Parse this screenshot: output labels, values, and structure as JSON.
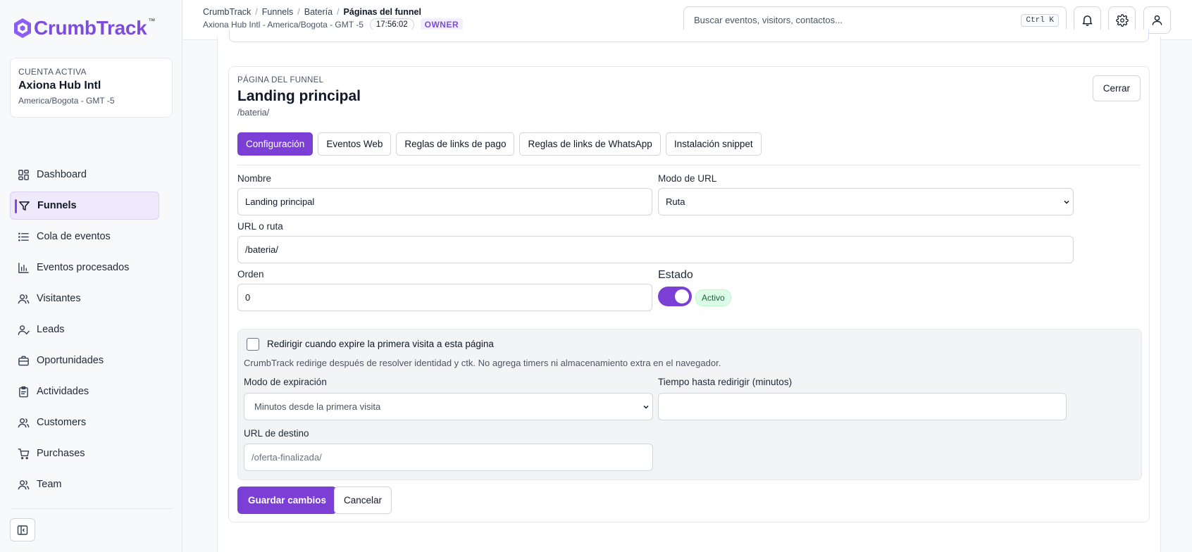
{
  "brand": {
    "name": "CrumbTrack",
    "tm": "™",
    "accent": "#7c3fd6"
  },
  "account": {
    "label": "CUENTA ACTIVA",
    "name": "Axiona Hub Intl",
    "timezone": "America/Bogota - GMT -5"
  },
  "nav": [
    {
      "label": "Dashboard",
      "icon": "dashboard-icon"
    },
    {
      "label": "Funnels",
      "icon": "filter-icon",
      "active": true
    },
    {
      "label": "Cola de eventos",
      "icon": "list-icon"
    },
    {
      "label": "Eventos procesados",
      "icon": "bar-chart-icon"
    },
    {
      "label": "Visitantes",
      "icon": "users-icon"
    },
    {
      "label": "Leads",
      "icon": "user-check-icon"
    },
    {
      "label": "Oportunidades",
      "icon": "briefcase-icon"
    },
    {
      "label": "Actividades",
      "icon": "clipboard-icon"
    },
    {
      "label": "Customers",
      "icon": "users-icon"
    },
    {
      "label": "Purchases",
      "icon": "cart-icon"
    },
    {
      "label": "Team",
      "icon": "users-icon"
    }
  ],
  "header": {
    "breadcrumb": [
      "CrumbTrack",
      "Funnels",
      "Batería",
      "Páginas del funnel"
    ],
    "account_info": "Axiona Hub Intl - America/Bogota - GMT -5",
    "clock": "17:56:02",
    "role": "OWNER",
    "search_placeholder": "Buscar eventos, visitors, contactos...",
    "shortcut": "Ctrl K"
  },
  "page": {
    "kicker": "PÁGINA DEL FUNNEL",
    "title": "Landing principal",
    "path": "/bateria/",
    "close_label": "Cerrar",
    "tabs": [
      "Configuración",
      "Eventos Web",
      "Reglas de links de pago",
      "Reglas de links de WhatsApp",
      "Instalación snippet"
    ],
    "active_tab": 0
  },
  "form": {
    "nombre_label": "Nombre",
    "nombre_value": "Landing principal",
    "modo_url_label": "Modo de URL",
    "modo_url_value": "Ruta",
    "url_label": "URL o ruta",
    "url_value": "/bateria/",
    "orden_label": "Orden",
    "orden_value": "0",
    "estado_label": "Estado",
    "estado_on": true,
    "estado_badge": "Activo",
    "redirect": {
      "checkbox_label": "Redirigir cuando expire la primera visita a esta página",
      "checked": false,
      "help": "CrumbTrack redirige después de resolver identidad y ctk. No agrega timers ni almacenamiento extra en el navegador.",
      "modo_label": "Modo de expiración",
      "modo_value": "Minutos desde la primera visita",
      "tiempo_label": "Tiempo hasta redirigir (minutos)",
      "tiempo_value": "",
      "destino_label": "URL de destino",
      "destino_placeholder": "/oferta-finalizada/"
    },
    "save_label": "Guardar cambios",
    "cancel_label": "Cancelar"
  }
}
